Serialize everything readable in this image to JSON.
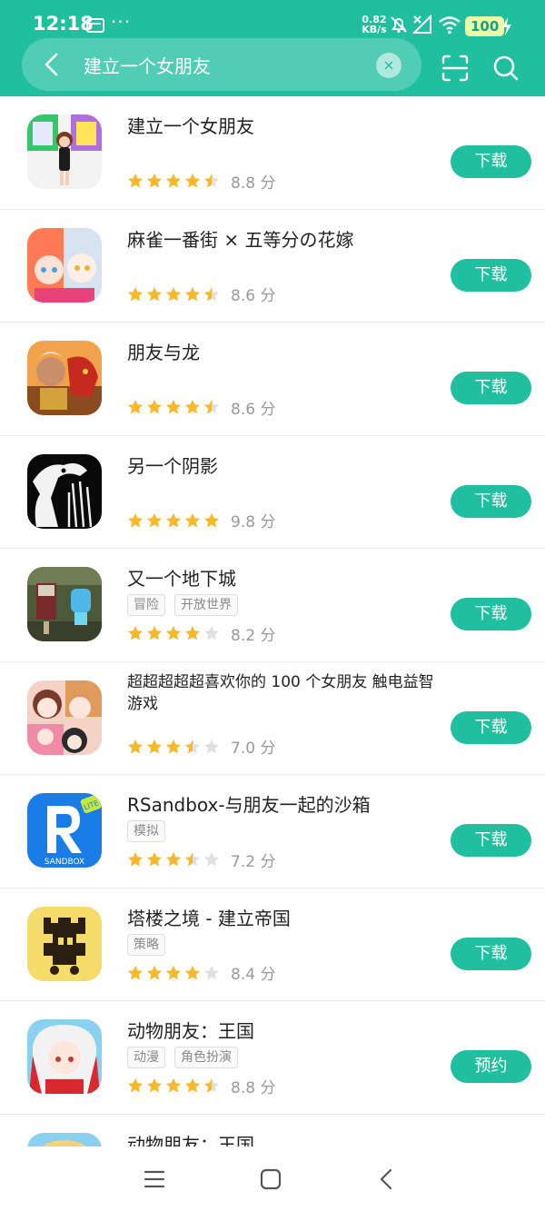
{
  "status_bar": {
    "time": "12:18",
    "more": "···",
    "speed_value": "0.82",
    "speed_unit": "KB/s",
    "battery": "100"
  },
  "search": {
    "query": "建立一个女朋友",
    "clear": "×"
  },
  "colors": {
    "accent": "#1fbf9f",
    "star_on": "#f7b82a",
    "star_off": "#e0e0e0"
  },
  "apps": [
    {
      "title": "建立一个女朋友",
      "tags": [],
      "score": "8.8 分",
      "rating": 4.5,
      "action": "下载",
      "icon": "app-girlfriend-builder-icon"
    },
    {
      "title": "麻雀一番街 × 五等分の花嫁",
      "tags": [],
      "score": "8.6 分",
      "rating": 4.5,
      "action": "下载",
      "icon": "app-mahjong-icon"
    },
    {
      "title": "朋友与龙",
      "tags": [],
      "score": "8.6 分",
      "rating": 4.5,
      "action": "下载",
      "icon": "app-dragon-icon"
    },
    {
      "title": "另一个阴影",
      "tags": [],
      "score": "9.8 分",
      "rating": 5,
      "action": "下载",
      "icon": "app-shadow-icon"
    },
    {
      "title": "又一个地下城",
      "tags": [
        "冒险",
        "开放世界"
      ],
      "score": "8.2 分",
      "rating": 4,
      "action": "下载",
      "icon": "app-dungeon-icon"
    },
    {
      "title": "超超超超超喜欢你的 100 个女朋友 触电益智游戏",
      "tags": [],
      "score": "7.0 分",
      "rating": 3.5,
      "action": "下载",
      "icon": "app-100-girlfriends-icon"
    },
    {
      "title": "RSandbox-与朋友一起的沙箱",
      "tags": [
        "模拟"
      ],
      "score": "7.2 分",
      "rating": 3.5,
      "action": "下载",
      "icon": "app-rsandbox-icon"
    },
    {
      "title": "塔楼之境 - 建立帝国",
      "tags": [
        "策略"
      ],
      "score": "8.4 分",
      "rating": 4,
      "action": "下载",
      "icon": "app-tower-icon"
    },
    {
      "title": "动物朋友：王国",
      "tags": [
        "动漫",
        "角色扮演"
      ],
      "score": "8.8 分",
      "rating": 4.5,
      "action": "预约",
      "icon": "app-kemono-icon"
    },
    {
      "title": "动物朋友：王国",
      "tags": [],
      "score": "",
      "rating": 0,
      "action": "",
      "icon": "app-kemono-2-icon"
    }
  ]
}
